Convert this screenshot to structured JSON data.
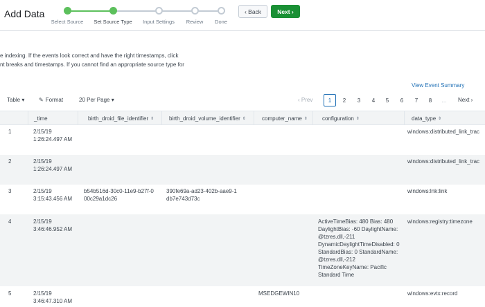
{
  "header": {
    "title": "Add Data",
    "steps": [
      {
        "label": "Select Source",
        "state": "done"
      },
      {
        "label": "Set Source Type",
        "state": "active"
      },
      {
        "label": "Input Settings",
        "state": "todo"
      },
      {
        "label": "Review",
        "state": "todo"
      },
      {
        "label": "Done",
        "state": "todo"
      }
    ],
    "back_label": "‹ Back",
    "next_label": "Next ›"
  },
  "intro": {
    "line1": "e indexing. If the events look correct and have the right timestamps, click",
    "line2": "nt breaks and timestamps. If you cannot find an appropriate source type for"
  },
  "summary_link": "View Event Summary",
  "toolbar": {
    "table_label": "Table ▾",
    "format_label": "Format",
    "per_page_label": "20 Per Page ▾",
    "prev_label": "‹ Prev",
    "pages": [
      "1",
      "2",
      "3",
      "4",
      "5",
      "6",
      "7",
      "8",
      "…"
    ],
    "current_page": "1",
    "next_label": "Next ›"
  },
  "table": {
    "columns": [
      "_time",
      "birth_droid_file_identifier",
      "birth_droid_volume_identifier",
      "computer_name",
      "configuration",
      "data_type"
    ],
    "rows": [
      {
        "num": "1",
        "time": "2/15/19 1:26:24.497 AM",
        "file_id": "",
        "volume_id": "",
        "computer": "",
        "config": "",
        "data_type": "windows:distributed_link_trac"
      },
      {
        "num": "2",
        "time": "2/15/19 1:26:24.497 AM",
        "file_id": "",
        "volume_id": "",
        "computer": "",
        "config": "",
        "data_type": "windows:distributed_link_trac"
      },
      {
        "num": "3",
        "time": "2/15/19 3:15:43.456 AM",
        "file_id": "b54b516d-30c0-11e9-b27f-000c29a1dc26",
        "volume_id": "390fe69a-ad23-402b-aae9-1db7e743d73c",
        "computer": "",
        "config": "",
        "data_type": "windows:lnk:link"
      },
      {
        "num": "4",
        "time": "2/15/19 3:46:46.952 AM",
        "file_id": "",
        "volume_id": "",
        "computer": "",
        "config": "ActiveTimeBias: 480 Bias: 480 DaylightBias: -60 DaylightName: @tzres.dll,-211 DynamicDaylightTimeDisabled: 0 StandardBias: 0 StandardName: @tzres.dll,-212 TimeZoneKeyName: Pacific Standard Time",
        "data_type": "windows:registry:timezone"
      },
      {
        "num": "5",
        "time": "2/15/19 3:46:47.310 AM",
        "file_id": "",
        "volume_id": "",
        "computer": "MSEDGEWIN10",
        "config": "",
        "data_type": "windows:evtx:record"
      }
    ]
  },
  "colors": {
    "accent": "#1e6fb5",
    "success": "#1a9035",
    "step_done": "#5cc05c",
    "row_alt": "#f2f4f5"
  },
  "icons": {
    "format": "pencil-icon",
    "sort": "sort-icon"
  }
}
